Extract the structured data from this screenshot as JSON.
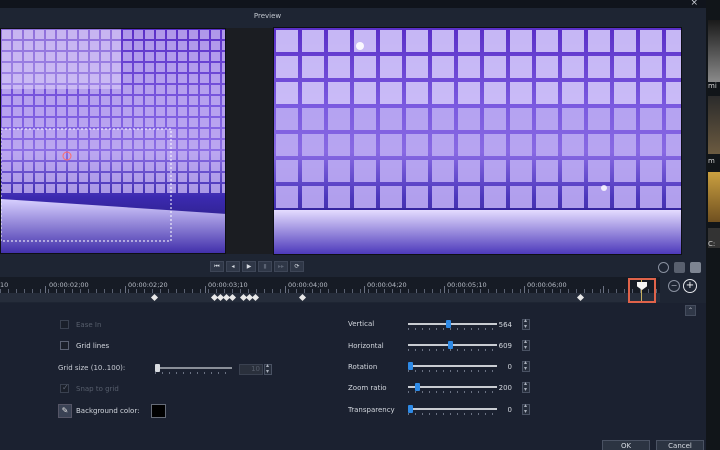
{
  "window": {
    "title": "Preview",
    "close_glyph": "×"
  },
  "side_labels": [
    "mi",
    "m",
    "C:"
  ],
  "playback": {
    "buttons": [
      "⏮",
      "◂",
      "▶",
      "▮",
      "▸▸",
      "⟳"
    ]
  },
  "timeline": {
    "ruler_labels": [
      "10",
      "00:00:02;00",
      "00:00:02;20",
      "00:00:03;10",
      "00:00:04;00",
      "00:00:04;20",
      "00:00:05;10",
      "00:00:06;00"
    ]
  },
  "options": {
    "ease_in": {
      "label": "Ease In",
      "checked": false,
      "enabled": false
    },
    "grid_lines": {
      "label": "Grid lines",
      "checked": false,
      "enabled": true
    },
    "grid_size": {
      "label": "Grid size (10..100):",
      "value": "10",
      "enabled": false
    },
    "snap_to_grid": {
      "label": "Snap to grid",
      "checked": true,
      "enabled": false
    },
    "background_color": {
      "label": "Background color:",
      "color": "#000000"
    }
  },
  "properties": [
    {
      "key": "vertical",
      "label": "Vertical",
      "value": "564",
      "level": 0.45
    },
    {
      "key": "horizontal",
      "label": "Horizontal",
      "value": "609",
      "level": 0.48
    },
    {
      "key": "rotation",
      "label": "Rotation",
      "value": "0",
      "level": 0.0
    },
    {
      "key": "zoom_ratio",
      "label": "Zoom ratio",
      "value": "200",
      "level": 0.08
    },
    {
      "key": "transparency",
      "label": "Transparency",
      "value": "0",
      "level": 0.0
    }
  ],
  "footer": {
    "ok_label": "OK",
    "cancel_label": "Cancel"
  },
  "colors": {
    "accent": "#2e8ae6",
    "highlight": "#e0634a"
  }
}
